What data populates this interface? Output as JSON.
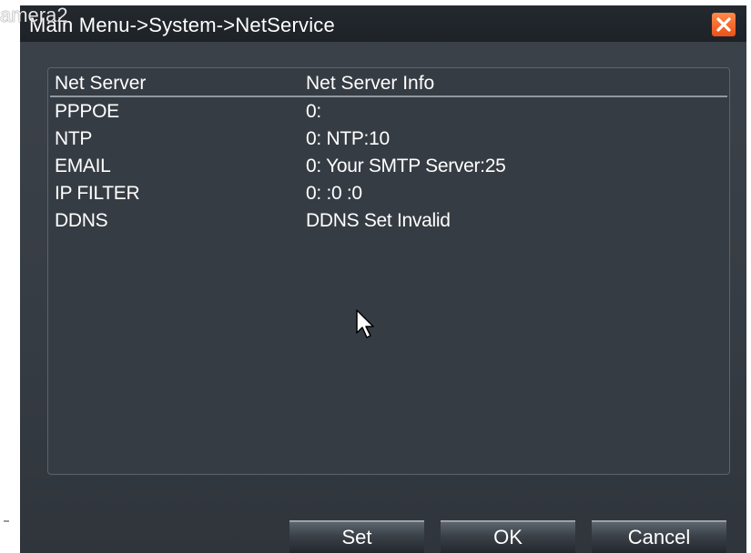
{
  "window": {
    "title": "Main Menu->System->NetService",
    "overlay_label": "amera2"
  },
  "table": {
    "headers": [
      "Net Server",
      "Net Server Info"
    ],
    "rows": [
      {
        "server": "PPPOE",
        "info": "0:"
      },
      {
        "server": "NTP",
        "info": "0: NTP:10"
      },
      {
        "server": "EMAIL",
        "info": "0: Your SMTP Server:25"
      },
      {
        "server": "IP FILTER",
        "info": "0: :0 :0"
      },
      {
        "server": "DDNS",
        "info": "DDNS Set Invalid"
      }
    ]
  },
  "buttons": {
    "set": "Set",
    "ok": "OK",
    "cancel": "Cancel"
  },
  "colors": {
    "background": "#3a4048",
    "titlebar": "#22272c",
    "close": "#ee6a2e",
    "text": "#ffffff"
  },
  "icons": {
    "close": "close-icon",
    "cursor": "mouse-pointer-icon"
  }
}
